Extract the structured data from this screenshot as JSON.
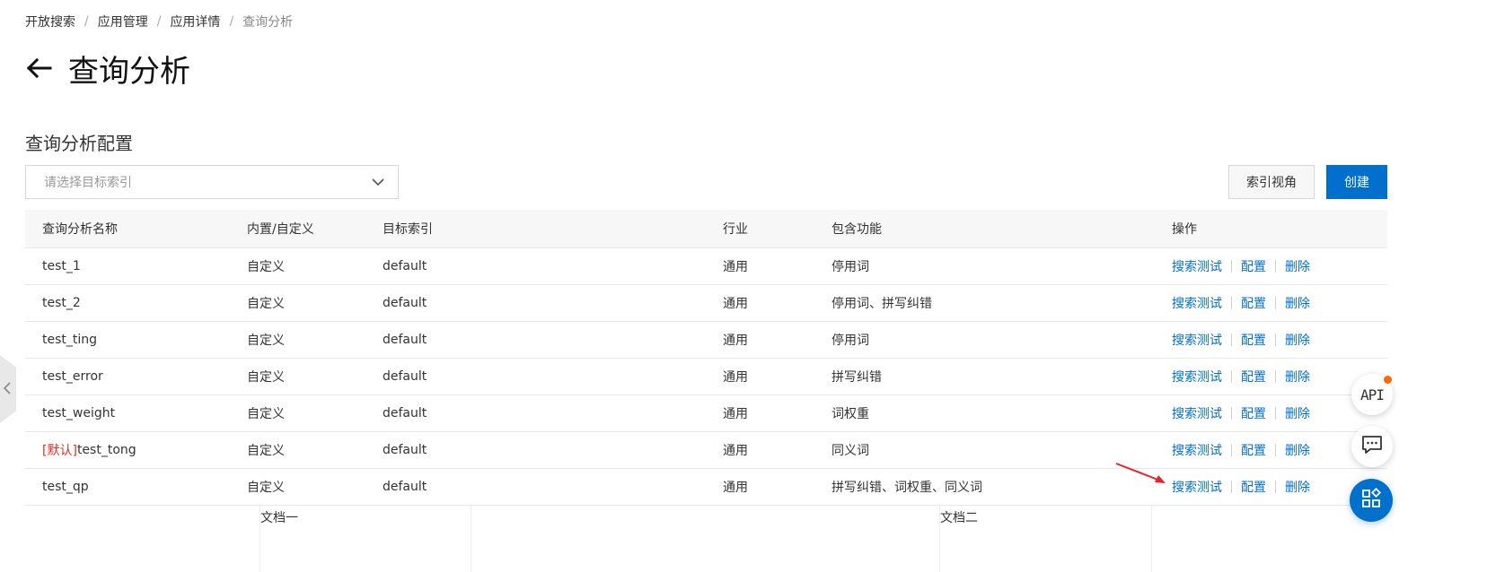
{
  "breadcrumb": {
    "items": [
      "开放搜索",
      "应用管理",
      "应用详情",
      "查询分析"
    ],
    "separator": "/"
  },
  "header": {
    "title": "查询分析",
    "back_icon": "arrow-left-icon"
  },
  "section": {
    "title": "查询分析配置"
  },
  "filter": {
    "placeholder": "请选择目标索引",
    "chevron_icon": "chevron-down-icon"
  },
  "toolbar": {
    "index_view_label": "索引视角",
    "create_label": "创建"
  },
  "table": {
    "columns": [
      "查询分析名称",
      "内置/自定义",
      "目标索引",
      "行业",
      "包含功能",
      "操作"
    ],
    "rows": [
      {
        "tag": "",
        "name": "test_1",
        "type": "自定义",
        "index": "default",
        "industry": "通用",
        "features": "停用词"
      },
      {
        "tag": "",
        "name": "test_2",
        "type": "自定义",
        "index": "default",
        "industry": "通用",
        "features": "停用词、拼写纠错"
      },
      {
        "tag": "",
        "name": "test_ting",
        "type": "自定义",
        "index": "default",
        "industry": "通用",
        "features": "停用词"
      },
      {
        "tag": "",
        "name": "test_error",
        "type": "自定义",
        "index": "default",
        "industry": "通用",
        "features": "拼写纠错"
      },
      {
        "tag": "",
        "name": "test_weight",
        "type": "自定义",
        "index": "default",
        "industry": "通用",
        "features": "词权重"
      },
      {
        "tag": "[默认]",
        "name": "test_tong",
        "type": "自定义",
        "index": "default",
        "industry": "通用",
        "features": "同义词"
      },
      {
        "tag": "",
        "name": "test_qp",
        "type": "自定义",
        "index": "default",
        "industry": "通用",
        "features": "拼写纠错、词权重、同义词"
      }
    ],
    "actions": {
      "search_test": "搜索测试",
      "config": "配置",
      "delete": "删除"
    }
  },
  "docs": {
    "doc1": "文档一",
    "doc2": "文档二"
  },
  "floating": {
    "api_label": "API",
    "chat_icon": "chat-icon",
    "apps_icon": "apps-icon"
  },
  "colors": {
    "primary": "#0070cc",
    "default_tag": "#d93026",
    "annotation_arrow": "#e8202a",
    "notify_dot": "#ff6a00"
  }
}
